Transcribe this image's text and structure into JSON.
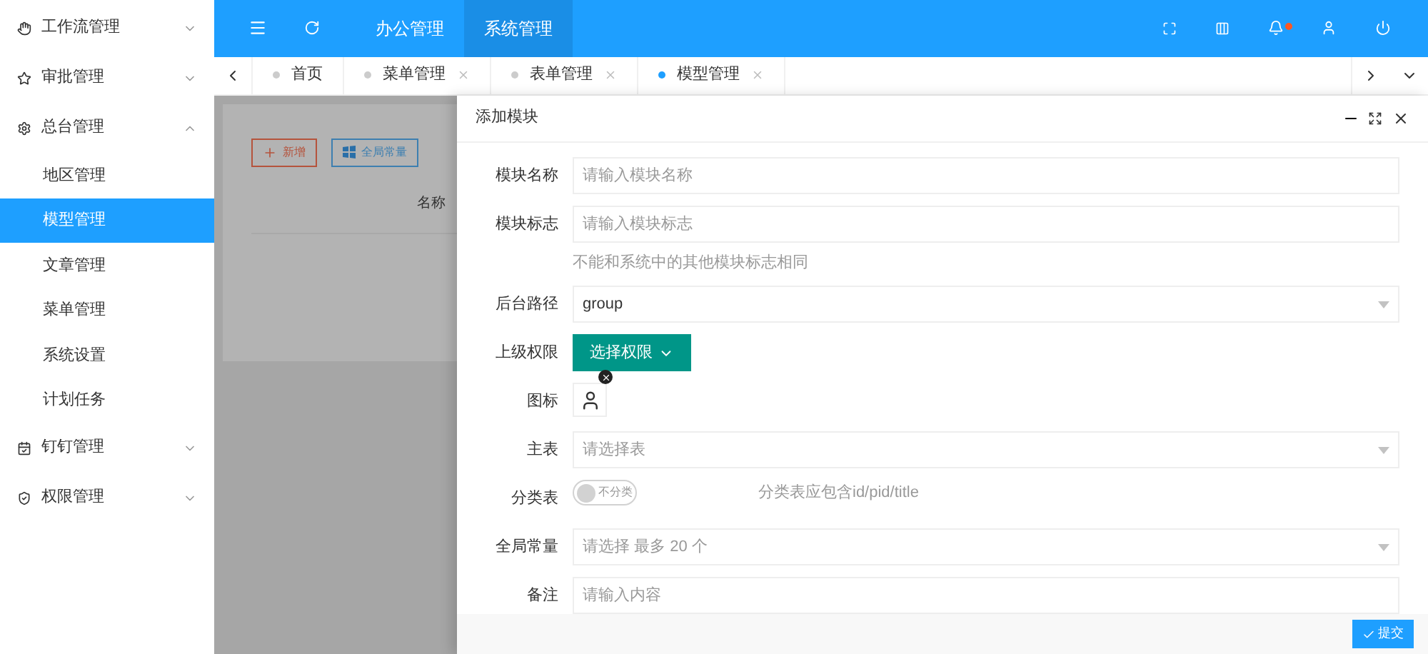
{
  "sidebar": {
    "items": [
      {
        "label": "工作流管理",
        "expanded": false,
        "selected": false
      },
      {
        "label": "审批管理",
        "expanded": false,
        "selected": false
      },
      {
        "label": "总台管理",
        "expanded": true,
        "selected": false,
        "children": [
          {
            "label": "地区管理",
            "selected": false
          },
          {
            "label": "模型管理",
            "selected": true
          },
          {
            "label": "文章管理",
            "selected": false
          },
          {
            "label": "菜单管理",
            "selected": false
          },
          {
            "label": "系统设置",
            "selected": false
          },
          {
            "label": "计划任务",
            "selected": false
          }
        ]
      },
      {
        "label": "钉钉管理",
        "expanded": false,
        "selected": false
      },
      {
        "label": "权限管理",
        "expanded": false,
        "selected": false
      }
    ]
  },
  "header": {
    "nav": [
      {
        "label": "办公管理",
        "selected": false
      },
      {
        "label": "系统管理",
        "selected": true
      }
    ]
  },
  "tabs": [
    {
      "label": "首页",
      "selected": false,
      "closable": false
    },
    {
      "label": "菜单管理",
      "selected": false,
      "closable": true
    },
    {
      "label": "表单管理",
      "selected": false,
      "closable": true
    },
    {
      "label": "模型管理",
      "selected": true,
      "closable": true
    }
  ],
  "page": {
    "buttons": [
      {
        "label": "新增",
        "kind": "add"
      },
      {
        "label": "全局常量",
        "kind": "constants"
      }
    ],
    "column": "名称"
  },
  "modal": {
    "title": "添加模块",
    "fields": [
      {
        "kind": "input",
        "label": "模块名称",
        "placeholder": "请输入模块名称"
      },
      {
        "kind": "input",
        "label": "模块标志",
        "placeholder": "请输入模块标志",
        "hint": "不能和系统中的其他模块标志相同"
      },
      {
        "kind": "select",
        "label": "后台路径",
        "value": "group"
      },
      {
        "kind": "button",
        "label": "上级权限",
        "button": "选择权限"
      },
      {
        "kind": "icon",
        "label": "图标"
      },
      {
        "kind": "select",
        "label": "主表",
        "placeholder": "请选择表"
      },
      {
        "kind": "switch",
        "label": "分类表",
        "on": false,
        "text": "不分类",
        "note": "分类表应包含id/pid/title"
      },
      {
        "kind": "select",
        "label": "全局常量",
        "placeholder": "请选择 最多 20 个"
      },
      {
        "kind": "input",
        "label": "备注",
        "placeholder": "请输入内容"
      }
    ],
    "submit": "提交"
  }
}
